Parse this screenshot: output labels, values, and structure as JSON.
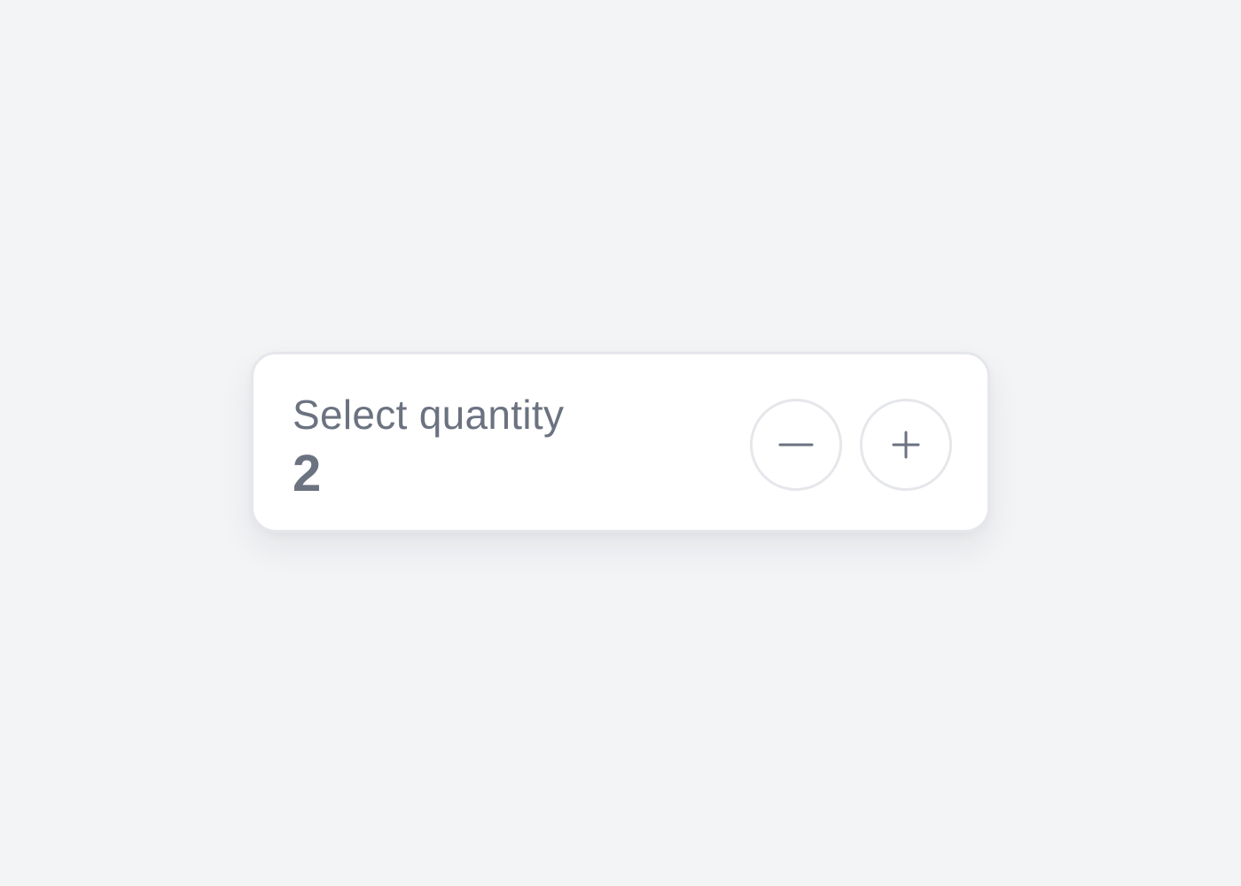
{
  "stepper": {
    "label": "Select quantity",
    "value": "2",
    "decrement_icon": "minus-icon",
    "increment_icon": "plus-icon"
  },
  "colors": {
    "background": "#f3f4f6",
    "card": "#ffffff",
    "border": "#e5e7eb",
    "text": "#6b7280"
  }
}
